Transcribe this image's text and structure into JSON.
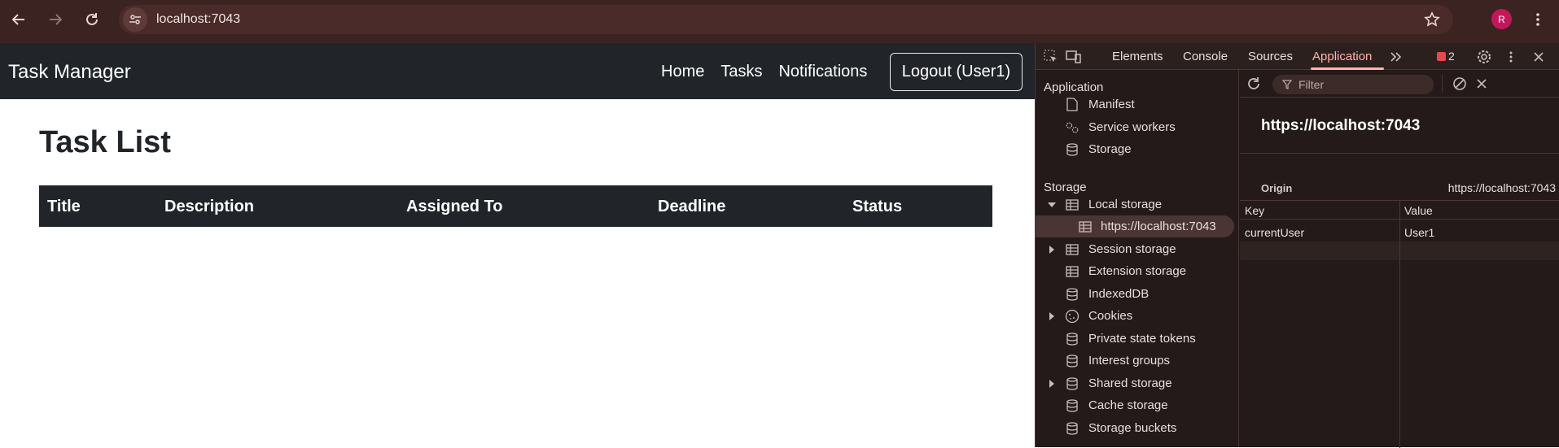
{
  "browser": {
    "url": "localhost:7043",
    "profile_initial": "R",
    "accent": "#3b2322"
  },
  "app": {
    "brand": "Task Manager",
    "nav": [
      "Home",
      "Tasks",
      "Notifications"
    ],
    "logout_label": "Logout (User1)",
    "page_title": "Task List",
    "table_headers": [
      "Title",
      "Description",
      "Assigned To",
      "Deadline",
      "Status"
    ]
  },
  "devtools": {
    "tabs": [
      "Elements",
      "Console",
      "Sources",
      "Application"
    ],
    "active_tab": "Application",
    "issues_count": "2",
    "sidebar": {
      "application_header": "Application",
      "application_items": [
        "Manifest",
        "Service workers",
        "Storage"
      ],
      "storage_header": "Storage",
      "storage_items": [
        "Local storage",
        "https://localhost:7043",
        "Session storage",
        "Extension storage",
        "IndexedDB",
        "Cookies",
        "Private state tokens",
        "Interest groups",
        "Shared storage",
        "Cache storage",
        "Storage buckets"
      ]
    },
    "filter_placeholder": "Filter",
    "origin_title": "https://localhost:7043",
    "origin_label": "Origin",
    "origin_value": "https://localhost:7043",
    "grid": {
      "headers": [
        "Key",
        "Value"
      ],
      "rows": [
        {
          "key": "currentUser",
          "value": "User1"
        }
      ]
    }
  }
}
